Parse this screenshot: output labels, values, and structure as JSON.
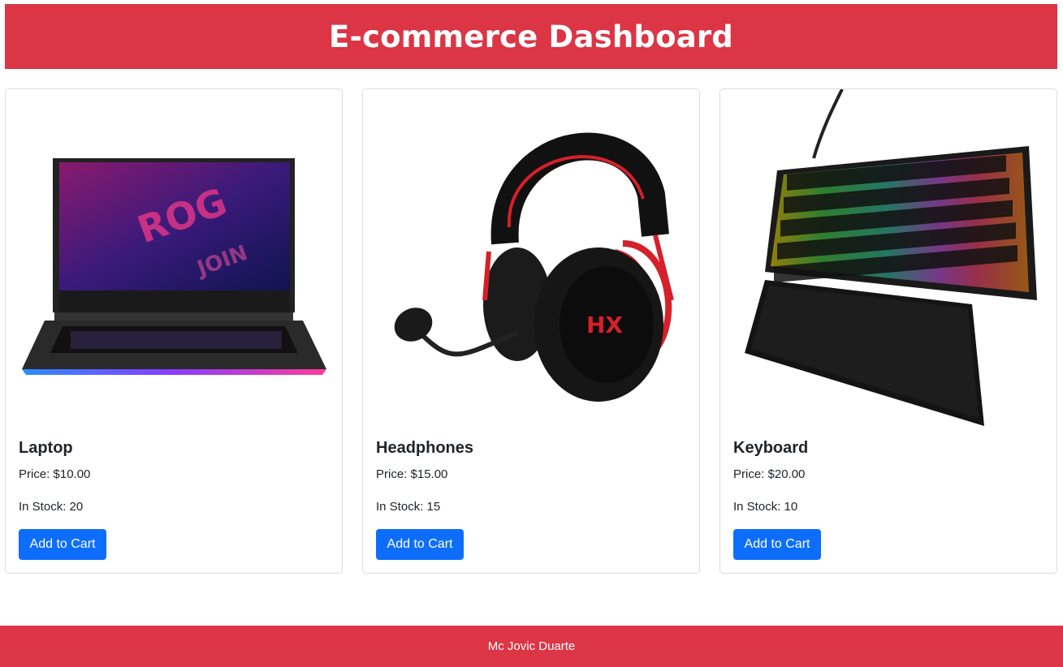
{
  "header": {
    "title": "E-commerce Dashboard"
  },
  "products": [
    {
      "name": "Laptop",
      "price": "Price: $10.00",
      "stock": "In Stock: 20",
      "button": "Add to Cart",
      "image_icon": "laptop-image"
    },
    {
      "name": "Headphones",
      "price": "Price: $15.00",
      "stock": "In Stock: 15",
      "button": "Add to Cart",
      "image_icon": "headphones-image"
    },
    {
      "name": "Keyboard",
      "price": "Price: $20.00",
      "stock": "In Stock: 10",
      "button": "Add to Cart",
      "image_icon": "keyboard-image"
    }
  ],
  "footer": {
    "text": "Mc Jovic Duarte"
  },
  "colors": {
    "brand": "#dc3545",
    "button": "#0d6efd",
    "border": "#dcdcdc"
  }
}
